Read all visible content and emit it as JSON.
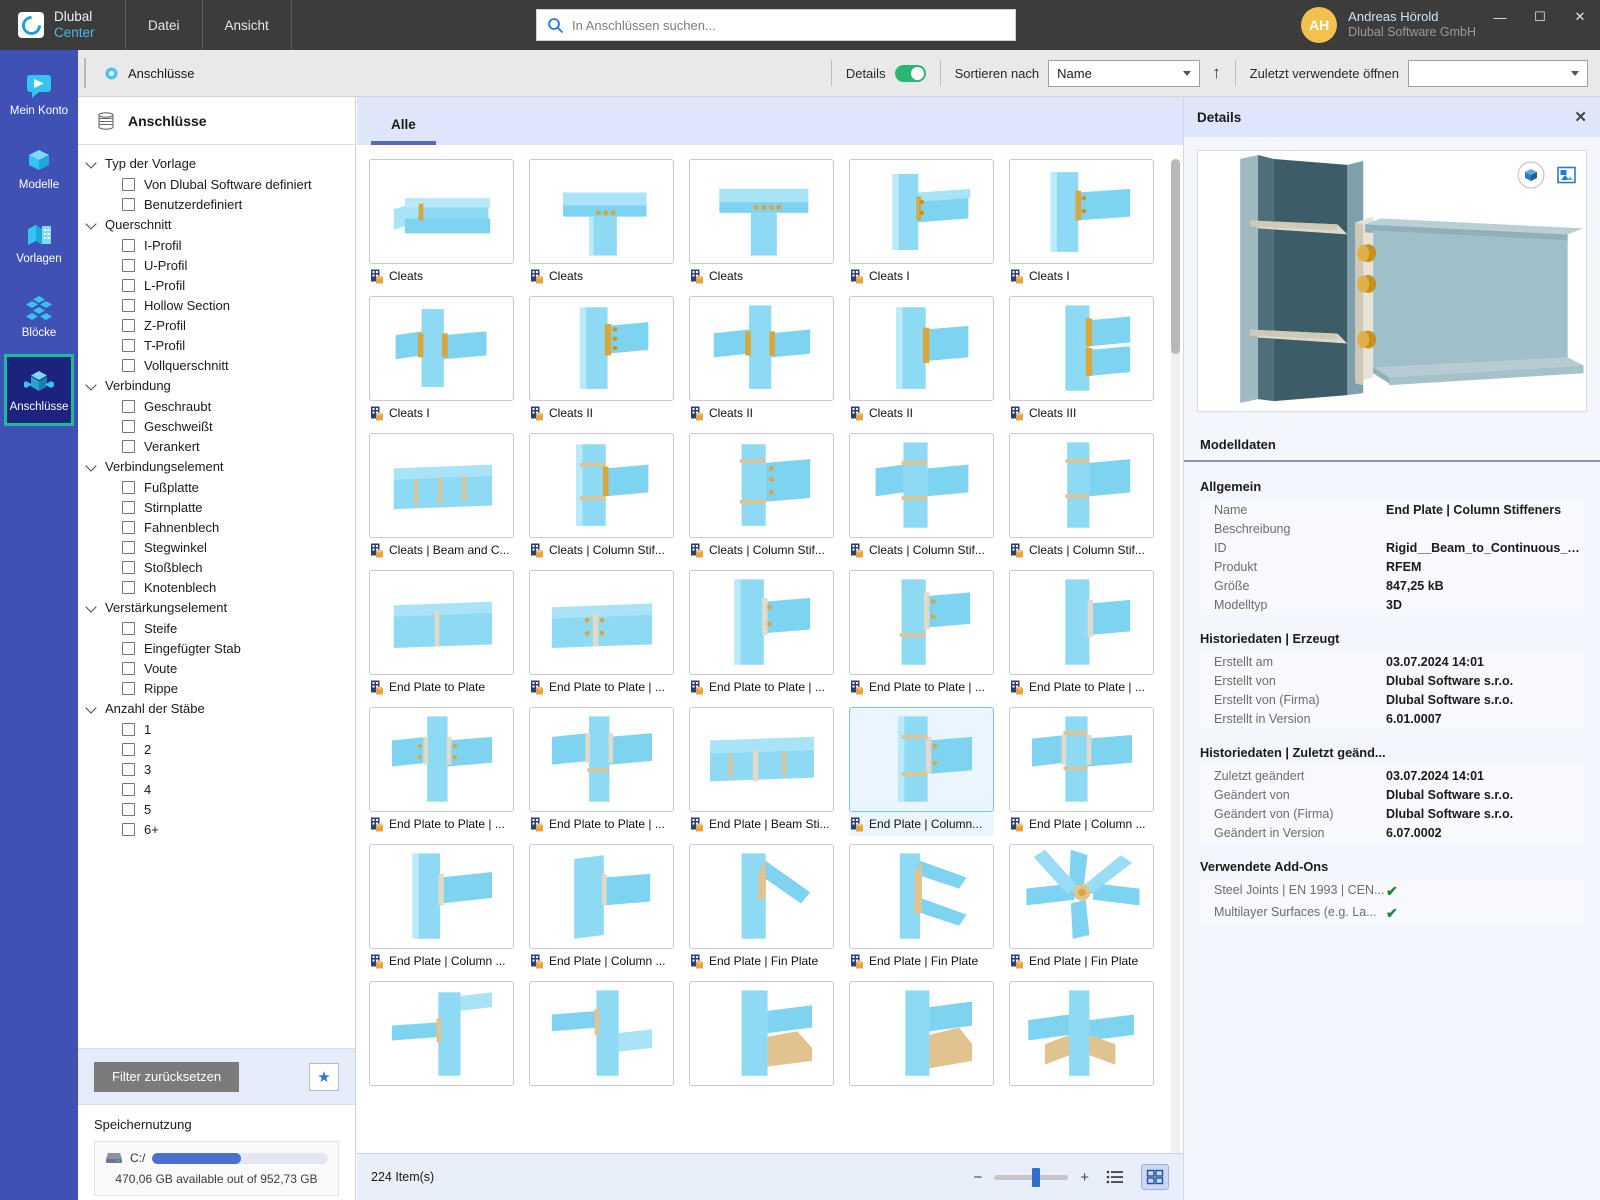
{
  "titlebar": {
    "brand_line1": "Dlubal",
    "brand_line2": "Center",
    "brand_logo_icon": "dlubal-logo-icon",
    "menus": [
      "Datei",
      "Ansicht"
    ],
    "search": {
      "placeholder": "In Anschlüssen suchen...",
      "value": "",
      "icon": "search-icon"
    },
    "user": {
      "initials": "AH",
      "name": "Andreas Hörold",
      "company": "Dlubal Software GmbH"
    },
    "window_buttons": {
      "minimize": "—",
      "maximize": "☐",
      "close": "✕"
    }
  },
  "rail": {
    "items": [
      {
        "label": "Mein Konto",
        "icon": "account-icon",
        "active": false
      },
      {
        "label": "Modelle",
        "icon": "models-cube-icon",
        "active": false
      },
      {
        "label": "Vorlagen",
        "icon": "templates-icon",
        "active": false
      },
      {
        "label": "Blöcke",
        "icon": "blocks-icon",
        "active": false
      },
      {
        "label": "Anschlüsse",
        "icon": "connections-icon",
        "active": true
      }
    ]
  },
  "toolbar": {
    "title": "Anschlüsse",
    "title_icon": "connections-small-icon",
    "details_label": "Details",
    "details_on": true,
    "sort_label": "Sortieren nach",
    "sort_value": "Name",
    "sort_direction_icon": "arrow-up-icon",
    "recent_label": "Zuletzt verwendete öffnen",
    "recent_value": ""
  },
  "filter": {
    "header": "Anschlüsse",
    "header_icon": "connections-list-icon",
    "groups": [
      {
        "title": "Typ der Vorlage",
        "options": [
          "Von Dlubal Software definiert",
          "Benutzerdefiniert"
        ]
      },
      {
        "title": "Querschnitt",
        "options": [
          "I-Profil",
          "U-Profil",
          "L-Profil",
          "Hollow Section",
          "Z-Profil",
          "T-Profil",
          "Vollquerschnitt"
        ]
      },
      {
        "title": "Verbindung",
        "options": [
          "Geschraubt",
          "Geschweißt",
          "Verankert"
        ]
      },
      {
        "title": "Verbindungselement",
        "options": [
          "Fußplatte",
          "Stirnplatte",
          "Fahnenblech",
          "Stegwinkel",
          "Stoßblech",
          "Knotenblech"
        ]
      },
      {
        "title": "Verstärkungselement",
        "options": [
          "Steife",
          "Eingefügter Stab",
          "Voute",
          "Rippe"
        ]
      },
      {
        "title": "Anzahl der Stäbe",
        "options": [
          "1",
          "2",
          "3",
          "4",
          "5",
          "6+"
        ]
      }
    ],
    "reset_label": "Filter zurücksetzen",
    "favorite_icon": "star-icon"
  },
  "storage": {
    "title": "Speichernutzung",
    "drive_label": "C:/",
    "drive_icon": "hard-drive-icon",
    "used_percent": 50.6,
    "note": "470,06 GB available out of 952,73 GB"
  },
  "main": {
    "tabs": [
      {
        "label": "Alle",
        "active": true
      }
    ],
    "status_count": "224 Item(s)",
    "zoom": {
      "minus": "−",
      "plus": "+",
      "position_percent": 57
    },
    "view_buttons": [
      {
        "icon": "list-view-icon",
        "active": false
      },
      {
        "icon": "grid-view-icon",
        "active": true
      }
    ],
    "items": [
      {
        "label": "Cleats",
        "thumb": "beam-to-beam-cleat",
        "selected": false
      },
      {
        "label": "Cleats",
        "thumb": "beam-on-column-cleat",
        "selected": false
      },
      {
        "label": "Cleats",
        "thumb": "beam-column-cleat-bolts",
        "selected": false
      },
      {
        "label": "Cleats I",
        "thumb": "column-beam-cleat-1",
        "selected": false
      },
      {
        "label": "Cleats I",
        "thumb": "column-beam-cleat-2",
        "selected": false
      },
      {
        "label": "Cleats I",
        "thumb": "beam-through-cleat",
        "selected": false
      },
      {
        "label": "Cleats II",
        "thumb": "column-double-cleat",
        "selected": false
      },
      {
        "label": "Cleats II",
        "thumb": "column-cleat-cross",
        "selected": false
      },
      {
        "label": "Cleats II",
        "thumb": "column-cleat-side",
        "selected": false
      },
      {
        "label": "Cleats III",
        "thumb": "column-cleat-triple",
        "selected": false
      },
      {
        "label": "Cleats | Beam and C...",
        "thumb": "beam-column-stiffener",
        "selected": false
      },
      {
        "label": "Cleats | Column Stif...",
        "thumb": "column-stiffener-1",
        "selected": false
      },
      {
        "label": "Cleats | Column Stif...",
        "thumb": "column-stiffener-2",
        "selected": false
      },
      {
        "label": "Cleats | Column Stif...",
        "thumb": "column-stiffener-3",
        "selected": false
      },
      {
        "label": "Cleats | Column Stif...",
        "thumb": "column-stiffener-4",
        "selected": false
      },
      {
        "label": "End Plate to Plate",
        "thumb": "endplate-to-plate",
        "selected": false
      },
      {
        "label": "End Plate to Plate | ...",
        "thumb": "endplate-plate-bolts",
        "selected": false
      },
      {
        "label": "End Plate to Plate | ...",
        "thumb": "endplate-column-1",
        "selected": false
      },
      {
        "label": "End Plate to Plate | ...",
        "thumb": "endplate-column-2",
        "selected": false
      },
      {
        "label": "End Plate to Plate | ...",
        "thumb": "endplate-column-3",
        "selected": false
      },
      {
        "label": "End Plate to Plate | ...",
        "thumb": "endplate-cross-1",
        "selected": false
      },
      {
        "label": "End Plate to Plate | ...",
        "thumb": "endplate-cross-2",
        "selected": false
      },
      {
        "label": "End Plate | Beam Sti...",
        "thumb": "endplate-beam-stiff",
        "selected": false
      },
      {
        "label": "End Plate | Column...",
        "thumb": "endplate-column-stiff",
        "selected": true
      },
      {
        "label": "End Plate | Column ...",
        "thumb": "endplate-column-stiff2",
        "selected": false
      },
      {
        "label": "End Plate | Column ...",
        "thumb": "endplate-col-a",
        "selected": false
      },
      {
        "label": "End Plate | Column ...",
        "thumb": "endplate-col-b",
        "selected": false
      },
      {
        "label": "End Plate | Fin Plate",
        "thumb": "endplate-fin-1",
        "selected": false
      },
      {
        "label": "End Plate | Fin Plate",
        "thumb": "endplate-fin-2",
        "selected": false
      },
      {
        "label": "End Plate | Fin Plate",
        "thumb": "endplate-fin-3",
        "selected": false
      },
      {
        "label": "",
        "thumb": "partial-row-1",
        "selected": false
      },
      {
        "label": "",
        "thumb": "partial-row-2",
        "selected": false
      },
      {
        "label": "",
        "thumb": "partial-row-3",
        "selected": false
      },
      {
        "label": "",
        "thumb": "partial-row-4",
        "selected": false
      },
      {
        "label": "",
        "thumb": "partial-row-5",
        "selected": false
      }
    ]
  },
  "details": {
    "header": "Details",
    "close_icon": "close-icon",
    "preview_buttons": [
      {
        "icon": "rotate-3d-icon"
      },
      {
        "icon": "image-view-icon"
      }
    ],
    "modeldata_title": "Modelldaten",
    "sections": [
      {
        "title": "Allgemein",
        "rows": [
          {
            "key": "Name",
            "value": "End Plate | Column Stiffeners"
          },
          {
            "key": "Beschreibung",
            "value": ""
          },
          {
            "key": "ID",
            "value": "Rigid__Beam_to_Continuous_Col..."
          },
          {
            "key": "Produkt",
            "value": "RFEM"
          },
          {
            "key": "Größe",
            "value": "847,25 kB"
          },
          {
            "key": "Modelltyp",
            "value": "3D"
          }
        ]
      },
      {
        "title": "Historiedaten | Erzeugt",
        "rows": [
          {
            "key": "Erstellt am",
            "value": "03.07.2024 14:01"
          },
          {
            "key": "Erstellt von",
            "value": "Dlubal Software s.r.o."
          },
          {
            "key": "Erstellt von (Firma)",
            "value": "Dlubal Software s.r.o."
          },
          {
            "key": "Erstellt in Version",
            "value": "6.01.0007"
          }
        ]
      },
      {
        "title": "Historiedaten | Zuletzt geänd...",
        "rows": [
          {
            "key": "Zuletzt geändert",
            "value": "03.07.2024 14:01"
          },
          {
            "key": "Geändert von",
            "value": "Dlubal Software s.r.o."
          },
          {
            "key": "Geändert von (Firma)",
            "value": "Dlubal Software s.r.o."
          },
          {
            "key": "Geändert in Version",
            "value": "6.07.0002"
          }
        ]
      },
      {
        "title": "Verwendete Add-Ons",
        "addons": [
          {
            "key": "Steel Joints | EN 1993 | CEN...",
            "value": "✔"
          },
          {
            "key": "Multilayer Surfaces (e.g. La...",
            "value": "✔"
          }
        ]
      }
    ]
  },
  "colors": {
    "accent_blue": "#3f51b5",
    "active_teal": "#1abc9c",
    "toggle_green": "#2bb673",
    "panel_lavender": "#dfe5fa",
    "titlebar_dark": "#3c3c3c"
  }
}
